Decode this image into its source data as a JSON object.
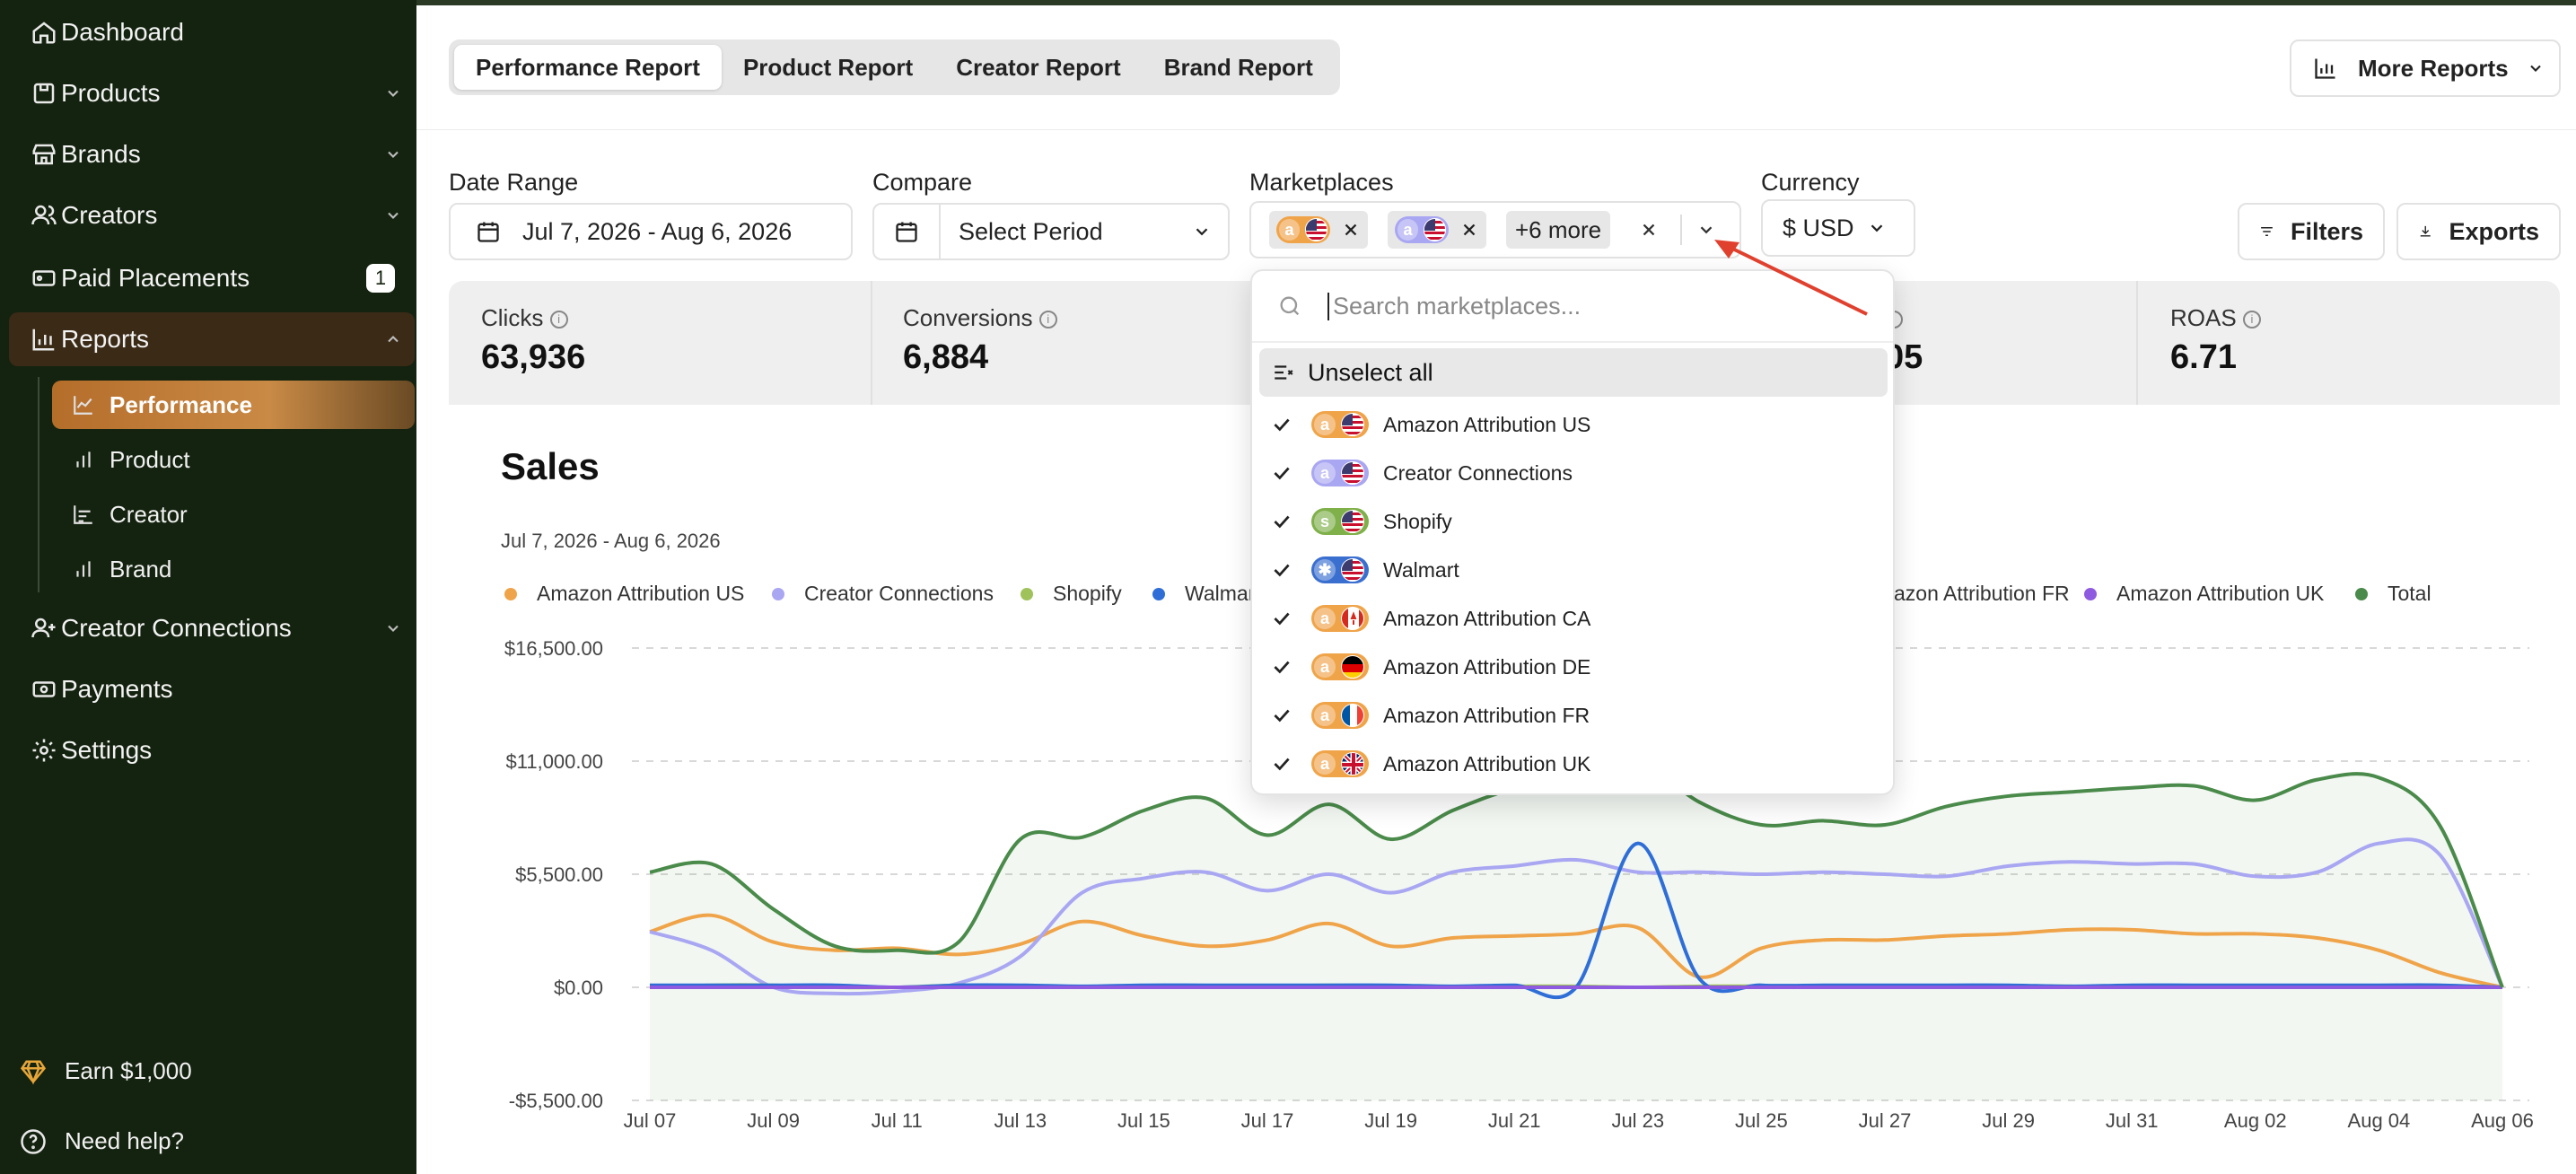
{
  "sidebar": {
    "items": [
      {
        "label": "Dashboard",
        "icon": "home-icon"
      },
      {
        "label": "Products",
        "icon": "box-icon"
      },
      {
        "label": "Brands",
        "icon": "store-icon"
      },
      {
        "label": "Creators",
        "icon": "users-icon"
      },
      {
        "label": "Paid Placements",
        "icon": "tag-icon",
        "badge": "1"
      },
      {
        "label": "Reports",
        "icon": "bar-chart-icon"
      },
      {
        "label": "Creator Connections",
        "icon": "user-plus-icon"
      },
      {
        "label": "Payments",
        "icon": "wallet-icon"
      },
      {
        "label": "Settings",
        "icon": "gear-icon"
      }
    ],
    "report_subitems": [
      {
        "label": "Performance"
      },
      {
        "label": "Product"
      },
      {
        "label": "Creator"
      },
      {
        "label": "Brand"
      }
    ],
    "earn": "Earn $1,000",
    "help": "Need help?"
  },
  "tabs": [
    "Performance Report",
    "Product Report",
    "Creator Report",
    "Brand Report"
  ],
  "more_reports": "More Reports",
  "filters": {
    "date_range_label": "Date Range",
    "date_range_value": "Jul 7, 2026 - Aug 6, 2026",
    "compare_label": "Compare",
    "compare_value": "Select Period",
    "marketplaces_label": "Marketplaces",
    "marketplaces_more": "+6 more",
    "currency_label": "Currency",
    "currency_value": "$ USD",
    "filters_button": "Filters",
    "exports_button": "Exports"
  },
  "stats": [
    {
      "label": "Clicks",
      "value": "63,936"
    },
    {
      "label": "Conversions",
      "value": "6,884"
    },
    {
      "label": "",
      "value": "05"
    },
    {
      "label": "ROAS",
      "value": "6.71"
    }
  ],
  "dropdown": {
    "search_placeholder": "Search marketplaces...",
    "unselect_all": "Unselect all",
    "options": [
      {
        "label": "Amazon Attribution US",
        "brand": "amazon",
        "flag": "us",
        "checked": true
      },
      {
        "label": "Creator Connections",
        "brand": "creator",
        "flag": "us",
        "checked": true
      },
      {
        "label": "Shopify",
        "brand": "shopify",
        "flag": "us",
        "checked": true
      },
      {
        "label": "Walmart",
        "brand": "walmart",
        "flag": "us",
        "checked": true
      },
      {
        "label": "Amazon Attribution CA",
        "brand": "amazon",
        "flag": "ca",
        "checked": true
      },
      {
        "label": "Amazon Attribution DE",
        "brand": "amazon",
        "flag": "de",
        "checked": true
      },
      {
        "label": "Amazon Attribution FR",
        "brand": "amazon",
        "flag": "fr",
        "checked": true
      },
      {
        "label": "Amazon Attribution UK",
        "brand": "amazon",
        "flag": "uk",
        "checked": true
      }
    ]
  },
  "chart_data": {
    "type": "area",
    "title": "Sales",
    "subtitle": "Jul 7, 2026 - Aug 6, 2026",
    "x": [
      "Jul 07",
      "Jul 08",
      "Jul 09",
      "Jul 10",
      "Jul 11",
      "Jul 12",
      "Jul 13",
      "Jul 14",
      "Jul 15",
      "Jul 16",
      "Jul 17",
      "Jul 18",
      "Jul 19",
      "Jul 20",
      "Jul 21",
      "Jul 22",
      "Jul 23",
      "Jul 24",
      "Jul 25",
      "Jul 26",
      "Jul 27",
      "Jul 28",
      "Jul 29",
      "Jul 30",
      "Jul 31",
      "Aug 01",
      "Aug 02",
      "Aug 03",
      "Aug 04",
      "Aug 05",
      "Aug 06"
    ],
    "x_ticks": [
      "Jul 07",
      "Jul 09",
      "Jul 11",
      "Jul 13",
      "Jul 15",
      "Jul 17",
      "Jul 19",
      "Jul 21",
      "Jul 23",
      "Jul 25",
      "Jul 27",
      "Jul 29",
      "Jul 31",
      "Aug 02",
      "Aug 04",
      "Aug 06"
    ],
    "y_ticks": [
      "$16,500.00",
      "$11,000.00",
      "$5,500.00",
      "$0.00",
      "-$5,500.00"
    ],
    "ylim": [
      -5500,
      16500
    ],
    "series": [
      {
        "name": "Amazon Attribution US",
        "color": "#f0a44a",
        "values": [
          2700,
          3500,
          2200,
          1800,
          1900,
          1600,
          2100,
          3200,
          2500,
          2000,
          2300,
          3100,
          2000,
          2400,
          2500,
          2600,
          2900,
          500,
          1900,
          2300,
          2300,
          2500,
          2600,
          2800,
          2800,
          2600,
          2600,
          2400,
          1800,
          700,
          0
        ]
      },
      {
        "name": "Creator Connections",
        "color": "#a9a6f2",
        "values": [
          2700,
          1800,
          0,
          -300,
          -200,
          200,
          1500,
          4600,
          5300,
          5600,
          4700,
          5500,
          4600,
          5600,
          5900,
          6200,
          5600,
          5600,
          5500,
          5600,
          5500,
          5400,
          5900,
          6100,
          6000,
          6000,
          5400,
          5600,
          7000,
          6400,
          0
        ]
      },
      {
        "name": "Shopify",
        "color": "#9fc25a",
        "values": [
          0,
          100,
          100,
          0,
          0,
          100,
          50,
          0,
          50,
          50,
          50,
          100,
          50,
          0,
          50,
          50,
          0,
          50,
          50,
          50,
          0,
          50,
          50,
          50,
          0,
          50,
          50,
          50,
          0,
          50,
          0
        ]
      },
      {
        "name": "Walmart",
        "color": "#2f6ed6",
        "values": [
          100,
          100,
          100,
          100,
          0,
          100,
          100,
          50,
          100,
          100,
          100,
          100,
          100,
          50,
          100,
          0,
          7000,
          400,
          100,
          100,
          100,
          100,
          100,
          50,
          100,
          100,
          100,
          100,
          100,
          100,
          0
        ]
      },
      {
        "name": "Amazon Attribution FR",
        "color": "#e79e4f",
        "values": [
          0,
          0,
          0,
          0,
          0,
          0,
          0,
          0,
          0,
          0,
          0,
          0,
          0,
          0,
          0,
          0,
          0,
          0,
          0,
          0,
          0,
          0,
          0,
          0,
          0,
          0,
          0,
          0,
          0,
          0,
          0
        ]
      },
      {
        "name": "Amazon Attribution UK",
        "color": "#8e5adf",
        "values": [
          0,
          0,
          0,
          0,
          0,
          0,
          0,
          0,
          0,
          0,
          0,
          0,
          0,
          0,
          0,
          0,
          0,
          0,
          0,
          0,
          0,
          0,
          0,
          0,
          0,
          0,
          0,
          0,
          0,
          0,
          0
        ]
      },
      {
        "name": "Total",
        "color": "#4a8a4a",
        "values": [
          5600,
          6000,
          3800,
          2000,
          1800,
          2200,
          7200,
          7300,
          8600,
          9200,
          7400,
          8900,
          7200,
          8600,
          9700,
          10500,
          11000,
          9000,
          7900,
          8100,
          7900,
          8800,
          9300,
          9500,
          9700,
          9800,
          9100,
          10100,
          10200,
          7800,
          0
        ]
      }
    ],
    "legend_visible": [
      "Amazon Attribution US",
      "Creator Connections",
      "Shopify",
      "Walmar",
      "azon Attribution FR",
      "Amazon Attribution UK",
      "Total"
    ],
    "grid": true
  }
}
